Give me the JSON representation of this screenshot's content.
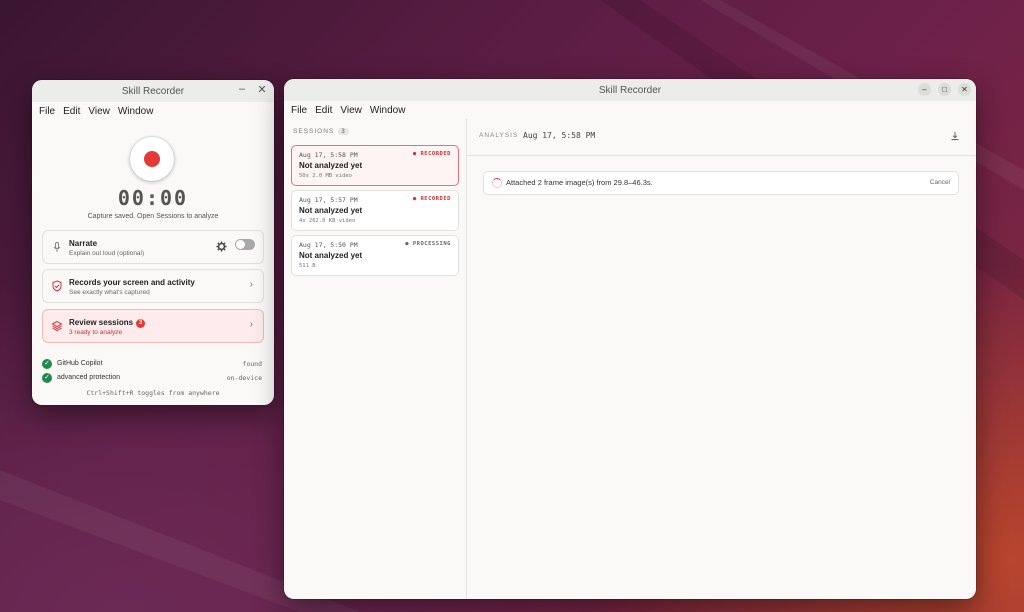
{
  "small_window": {
    "title": "Skill Recorder",
    "menu": [
      "File",
      "Edit",
      "View",
      "Window"
    ],
    "timer": "00:00",
    "capture_note": "Capture saved. Open Sessions to analyze",
    "narrate": {
      "title": "Narrate",
      "subtitle": "Explain out loud (optional)",
      "enabled": false
    },
    "records": {
      "title": "Records your screen and activity",
      "subtitle": "See exactly what's captured"
    },
    "review": {
      "title": "Review sessions",
      "badge": "3",
      "subtitle": "3 ready to analyze"
    },
    "status": [
      {
        "name": "GitHub Copilot",
        "value": "found"
      },
      {
        "name": "advanced protection",
        "value": "on-device"
      }
    ],
    "hint": "Ctrl+Shift+R toggles from anywhere"
  },
  "big_window": {
    "title": "Skill Recorder",
    "menu": [
      "File",
      "Edit",
      "View",
      "Window"
    ],
    "sessions_label": "SESSIONS",
    "sessions_count": "3",
    "sessions": [
      {
        "date": "Aug 17, 5:58 PM",
        "status": "● RECORDED",
        "title": "Not analyzed yet",
        "meta": "50s  2.0 MB  video",
        "active": true
      },
      {
        "date": "Aug 17, 5:57 PM",
        "status": "● RECORDED",
        "title": "Not analyzed yet",
        "meta": "4s  262.0 KB  video",
        "active": false
      },
      {
        "date": "Aug 17, 5:50 PM",
        "status": "● PROCESSING",
        "title": "Not analyzed yet",
        "meta": "511 B",
        "active": false
      }
    ],
    "analysis_label": "ANALYSIS",
    "analysis_date": "Aug 17, 5:58 PM",
    "banner_text": "Attached 2 frame image(s) from 29.8–46.3s.",
    "banner_cancel": "Cancel"
  },
  "colors": {
    "accent_red": "#e53935",
    "success_green": "#1f8a4c"
  }
}
